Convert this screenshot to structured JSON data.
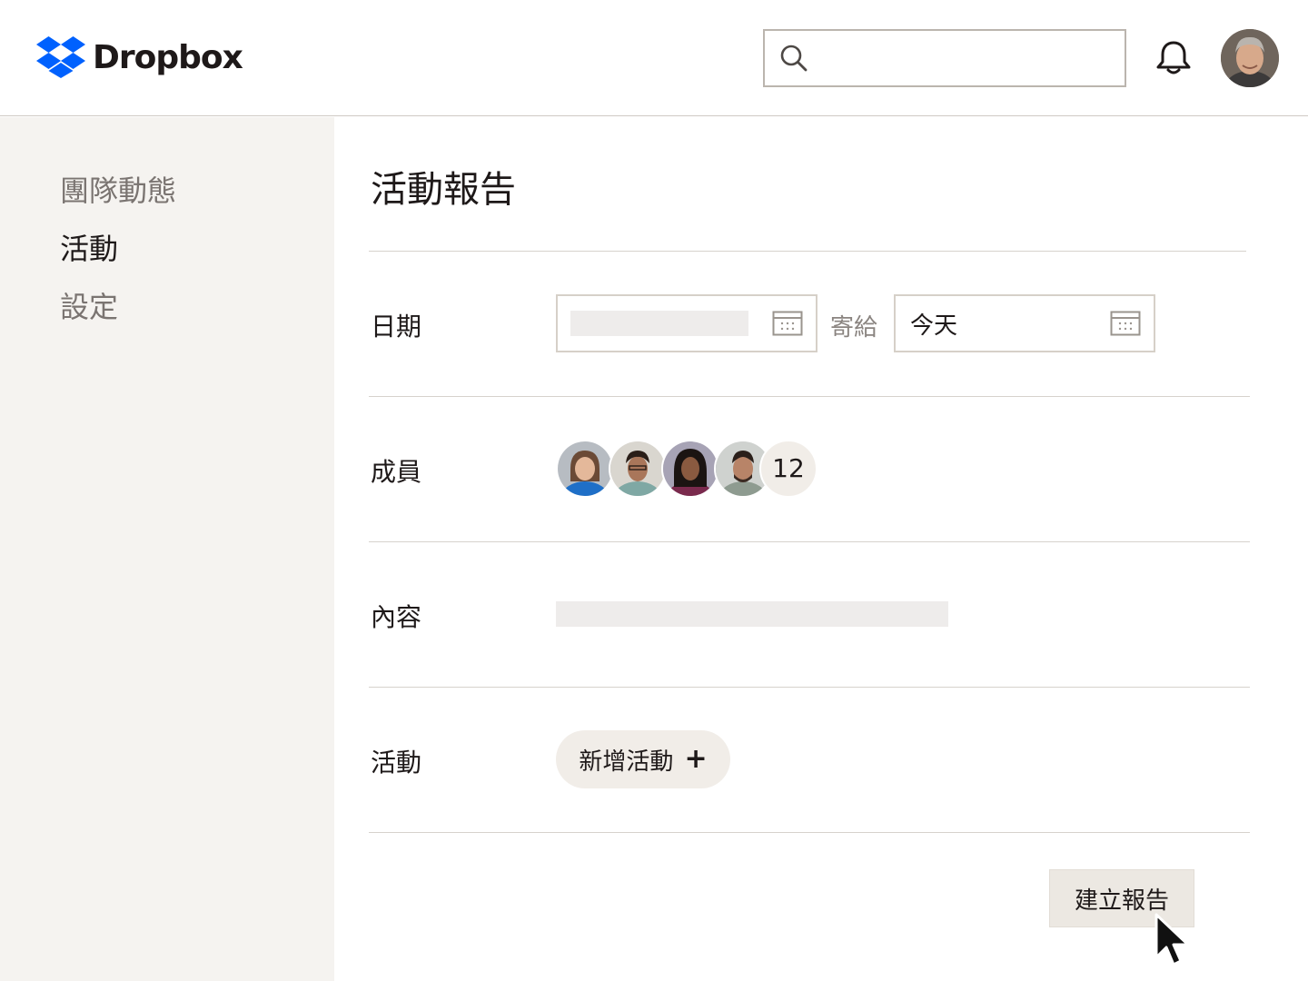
{
  "app": {
    "brand_name": "Dropbox",
    "logo_icon": "dropbox-logo-icon",
    "brand_color": "#0061fe"
  },
  "header": {
    "search_placeholder": "",
    "search_icon": "search-icon",
    "notification_icon": "bell-icon",
    "avatar": "user-avatar"
  },
  "sidebar": {
    "items": [
      {
        "label": "團隊動態",
        "active": false
      },
      {
        "label": "活動",
        "active": true
      },
      {
        "label": "設定",
        "active": false
      }
    ]
  },
  "main": {
    "title": "活動報告",
    "date": {
      "label": "日期",
      "from_value": "",
      "to_label": "寄給",
      "to_value": "今天",
      "calendar_icon": "calendar-icon"
    },
    "members": {
      "label": "成員",
      "count": "12"
    },
    "content": {
      "label": "內容"
    },
    "activity": {
      "label": "活動",
      "add_button_label": "新增活動",
      "add_icon": "plus-icon"
    },
    "create_button_label": "建立報告"
  }
}
